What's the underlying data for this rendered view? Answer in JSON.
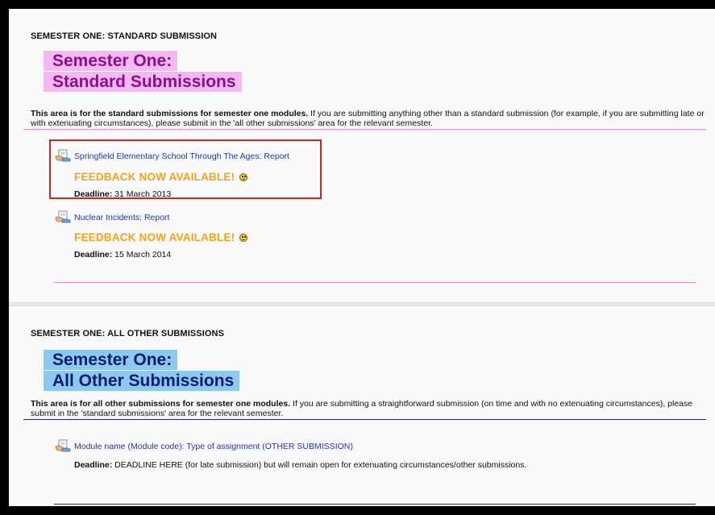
{
  "section1": {
    "heading": "SEMESTER ONE: STANDARD SUBMISSION",
    "banner_line1": "Semester One:",
    "banner_line2": "Standard Submissions",
    "intro_bold": "This area is for the standard submissions for semester one modules.",
    "intro_rest": " If you are submitting anything other than a standard submission (for example, if you are submitting late or with extenuating circumstances), please submit in the 'all other submissions' area for the relevant semester.",
    "activities": [
      {
        "title": "Springfield Elementary School Through The Ages: Report",
        "feedback": "FEEDBACK NOW AVAILABLE!",
        "deadline_label": "Deadline:",
        "deadline_value": " 31 March 2013"
      },
      {
        "title": "Nuclear Incidents: Report",
        "feedback": "FEEDBACK NOW AVAILABLE!",
        "deadline_label": "Deadline:",
        "deadline_value": " 15 March 2014"
      }
    ]
  },
  "section2": {
    "heading": "SEMESTER ONE: ALL OTHER SUBMISSIONS",
    "banner_line1": "Semester One:",
    "banner_line2": "All Other Submissions",
    "intro_bold": "This area is for all other submissions for semester one modules.",
    "intro_rest": " If you are submitting a straightforward submission (on time and with no extenuating circumstances), please submit in the 'standard submissions' area for the relevant semester.",
    "activities": [
      {
        "title": "Module name (Module code): Type of assignment (OTHER SUBMISSION)",
        "deadline_label": "Deadline:",
        "deadline_value": " DEADLINE HERE (for late submission) but will remain open for extenuating circumstances/other submissions."
      }
    ]
  },
  "colors": {
    "pink_banner_bg": "#f6b8f3",
    "pink_banner_text": "#8b0f8b",
    "blue_banner_bg": "#8ec8ee",
    "blue_banner_text": "#0b1d6e",
    "feedback_orange": "#f5a21c",
    "link_blue": "#2233bb",
    "highlight_red": "#d1232a"
  },
  "icons": {
    "assignment": "assignment-doc-icon",
    "smiley": "smiley-icon"
  }
}
